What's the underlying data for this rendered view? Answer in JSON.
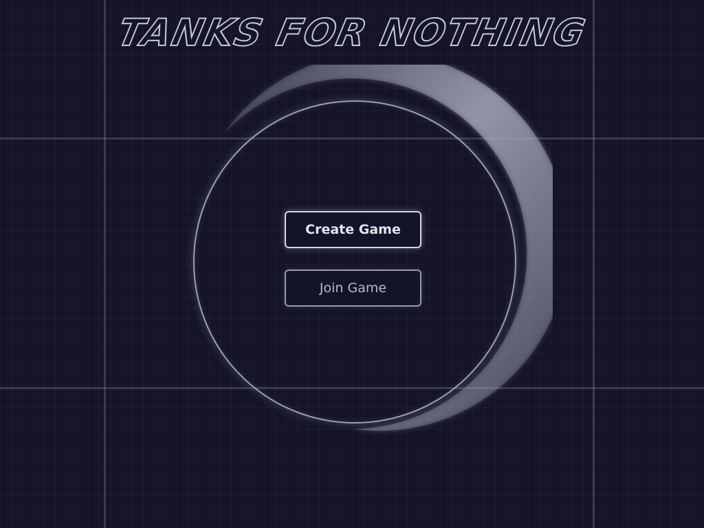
{
  "game": {
    "title": "TANKS FOR NOTHING"
  },
  "menu": {
    "create_label": "Create Game",
    "join_label": "Join Game"
  },
  "theme": {
    "background": "#141426",
    "accent": "#d8d8e6"
  }
}
